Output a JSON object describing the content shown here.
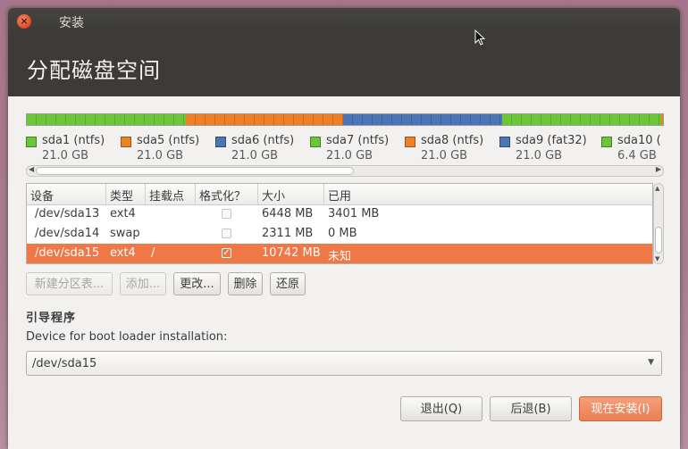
{
  "window": {
    "title": "安装",
    "close_glyph": "×"
  },
  "header": {
    "title": "分配磁盘空间"
  },
  "partition_bar": {
    "segments": [
      {
        "name": "sda1",
        "color": "#6cc63a"
      },
      {
        "name": "sda5",
        "color": "#ee8128"
      },
      {
        "name": "sda6",
        "color": "#4b75b4"
      },
      {
        "name": "sda7",
        "color": "#6cc63a"
      }
    ]
  },
  "legend": [
    {
      "name": "sda1 (ntfs)",
      "size": "21.0 GB",
      "color": "#6cc63a"
    },
    {
      "name": "sda5 (ntfs)",
      "size": "21.0 GB",
      "color": "#ee8128"
    },
    {
      "name": "sda6 (ntfs)",
      "size": "21.0 GB",
      "color": "#4b75b4"
    },
    {
      "name": "sda7 (ntfs)",
      "size": "21.0 GB",
      "color": "#6cc63a"
    },
    {
      "name": "sda8 (ntfs)",
      "size": "21.0 GB",
      "color": "#ee8128"
    },
    {
      "name": "sda9 (fat32)",
      "size": "21.0 GB",
      "color": "#4b75b4"
    },
    {
      "name": "sda10 (",
      "size": "6.4 GB",
      "color": "#6cc63a"
    }
  ],
  "table": {
    "headers": [
      "设备",
      "类型",
      "挂载点",
      "格式化？",
      "大小",
      "已用"
    ],
    "rows": [
      {
        "device": "/dev/sda13",
        "type": "ext4",
        "mount": "",
        "format": false,
        "size": "6448 MB",
        "used": "3401 MB",
        "selected": false
      },
      {
        "device": "/dev/sda14",
        "type": "swap",
        "mount": "",
        "format": false,
        "size": "2311 MB",
        "used": "0 MB",
        "selected": false
      },
      {
        "device": "/dev/sda15",
        "type": "ext4",
        "mount": "/",
        "format": true,
        "size": "10742 MB",
        "used": "未知",
        "selected": true
      }
    ]
  },
  "actions": {
    "new_table": "新建分区表...",
    "add": "添加...",
    "change": "更改...",
    "delete": "删除",
    "revert": "还原"
  },
  "bootloader": {
    "section_title": "引导程序",
    "label": "Device for boot loader installation:",
    "value": "/dev/sda15"
  },
  "footer": {
    "quit": "退出(Q)",
    "back": "后退(B)",
    "install": "现在安装(I)"
  },
  "colors": {
    "accent": "#f07746",
    "header_bg": "#3c3b37",
    "ntfs_green": "#6cc63a",
    "ntfs_orange": "#ee8128",
    "fat_blue": "#4b75b4"
  }
}
